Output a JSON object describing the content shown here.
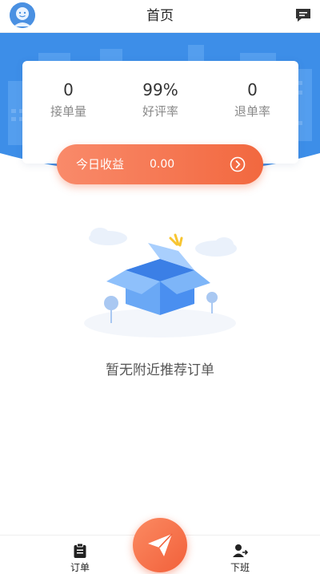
{
  "header": {
    "title": "首页",
    "avatar_icon": "avatar-face-icon",
    "message_icon": "message-icon"
  },
  "stats": [
    {
      "value": "0",
      "label": "接单量"
    },
    {
      "value": "99%",
      "label": "好评率"
    },
    {
      "value": "0",
      "label": "退单率"
    }
  ],
  "earnings": {
    "label": "今日收益",
    "value": "0.00",
    "arrow_icon": "chevron-right-circle-icon"
  },
  "empty_state": {
    "message": "暂无附近推荐订单",
    "illustration": "open-box-icon"
  },
  "bottom_nav": {
    "left": {
      "label": "订单",
      "icon": "clipboard-icon"
    },
    "center": {
      "icon": "paper-plane-icon"
    },
    "right": {
      "label": "下班",
      "icon": "user-logout-icon"
    }
  },
  "colors": {
    "banner_blue": "#3d8ee8",
    "accent_orange": "#f2683f"
  }
}
